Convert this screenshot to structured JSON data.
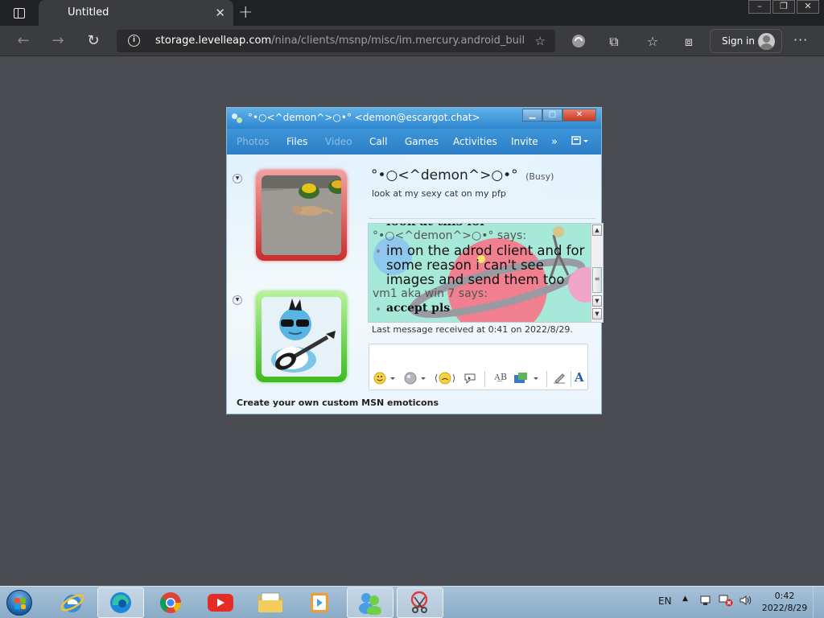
{
  "browser": {
    "tab_title": "Untitled",
    "new_tab_glyph": "+",
    "url_host": "storage.levelleap.com",
    "url_path": "/nina/clients/msnp/misc/im.mercury.android_build...",
    "signin_label": "Sign in",
    "window_buttons": [
      "–",
      "❐",
      "✕"
    ]
  },
  "msn": {
    "window_title": "°•○<^demon^>○•° <demon@escargot.chat>",
    "menu": [
      {
        "label": "Photos",
        "disabled": true
      },
      {
        "label": "Files",
        "disabled": false
      },
      {
        "label": "Video",
        "disabled": true
      },
      {
        "label": "Call",
        "disabled": false
      },
      {
        "label": "Activities",
        "disabled": false
      },
      {
        "label": "Games",
        "disabled": false
      },
      {
        "label": "Invite",
        "disabled": false
      }
    ],
    "menu_labels": {
      "photos": "Photos",
      "files": "Files",
      "video": "Video",
      "call": "Call",
      "games": "Games",
      "activities": "Activities",
      "invite": "Invite",
      "more": "»"
    },
    "contact": {
      "name": "°•○<^demon^>○•°",
      "status": "(Busy)",
      "personal_message": "look at my sexy cat on my pfp"
    },
    "chat": {
      "clipped_line": "look at this lol",
      "sender1": "°•○<^demon^>○•° says:",
      "message1": "im on the adrod client and for some reason i can't see images and send them too",
      "sender2": "vm1 aka win 7 says:",
      "message2": "accept pls"
    },
    "last_message": "Last message received at 0:41 on 2022/8/29.",
    "footer_ad": "Create your own custom MSN emoticons",
    "input_toolbar": {
      "font_glyph": "A"
    }
  },
  "taskbar": {
    "apps": [
      "internet-explorer",
      "edge",
      "chrome",
      "youtube",
      "file-explorer",
      "media-player",
      "windows-live-messenger",
      "snipping-tool"
    ],
    "language": "EN",
    "clock_time": "0:42",
    "clock_date": "2022/8/29"
  },
  "colors": {
    "browser_chrome": "#3b3c40",
    "msn_accent": "#2d7ec6",
    "busy_frame": "#c92e2e",
    "online_frame": "#3dba20",
    "taskbar": "#9bb8d0"
  }
}
